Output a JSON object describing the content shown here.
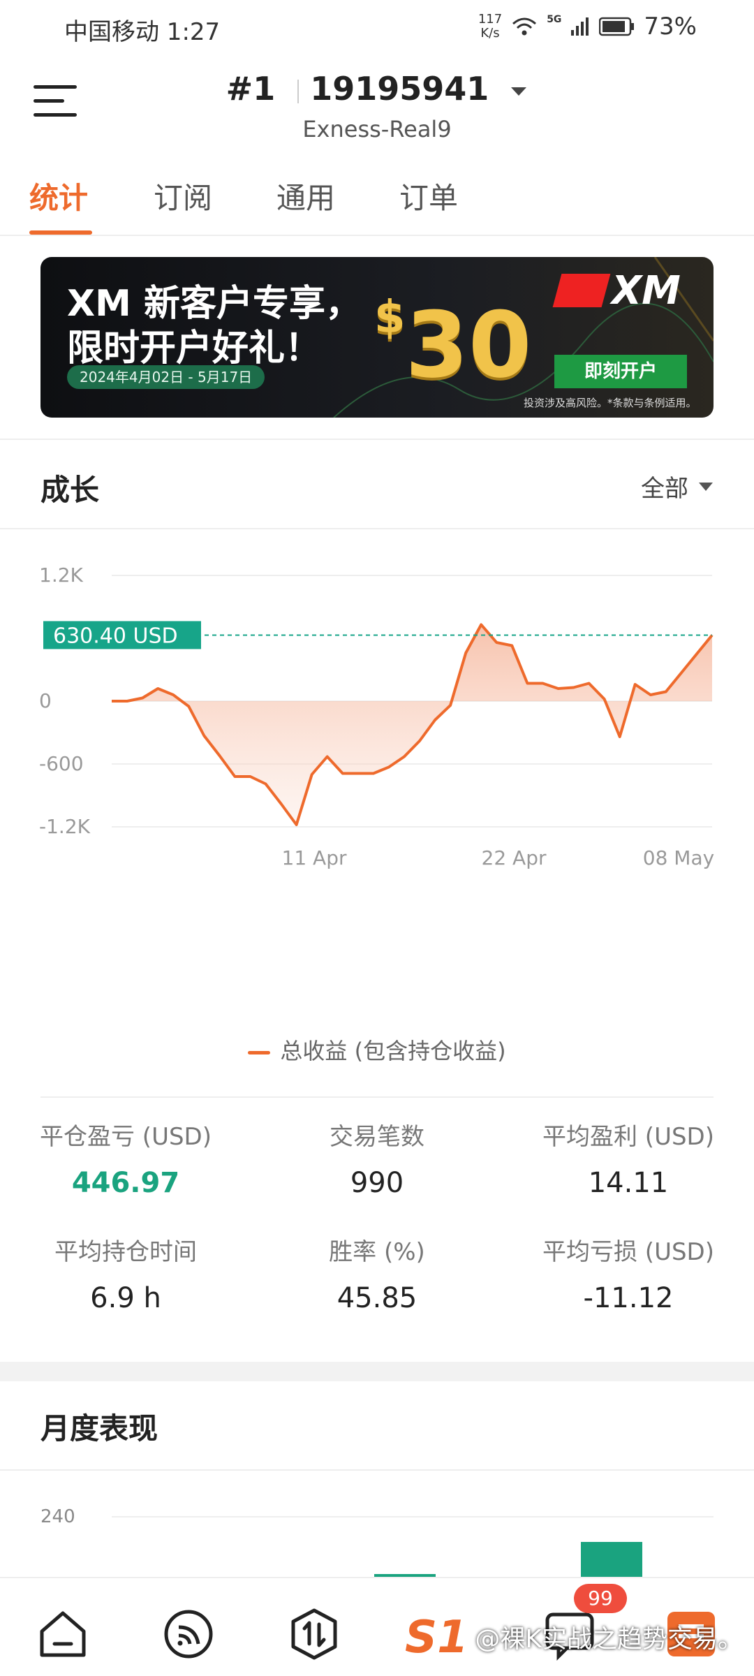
{
  "status_bar": {
    "carrier_time": "中国移动 1:27",
    "net_rate_value": "117",
    "net_rate_unit": "K/s",
    "network": "5G",
    "battery": "73%"
  },
  "header": {
    "rank": "#1",
    "account_number": "19195941",
    "server": "Exness-Real9"
  },
  "tabs": [
    "统计",
    "订阅",
    "通用",
    "订单"
  ],
  "banner": {
    "line1": "XM 新客户专享，",
    "line2": "限时开户好礼！",
    "date_range": "2024年4月02日 - 5月17日",
    "currency": "$",
    "amount": "30",
    "brand": "XM",
    "cta": "即刻开户",
    "disclaimer": "投资涉及高风险。*条款与条例适用。"
  },
  "growth": {
    "title": "成长",
    "range": "全部"
  },
  "chart_data": {
    "type": "area",
    "y_ticks": [
      "1.2K",
      "0",
      "-600",
      "-1.2K"
    ],
    "x_ticks": [
      "11 Apr",
      "22 Apr",
      "08 May"
    ],
    "ylim": [
      -1200,
      1200
    ],
    "current_value_label": "630.40 USD",
    "current_value": 630.4,
    "series": [
      {
        "name": "总收益 (包含持仓收益)",
        "values": [
          0,
          0,
          30,
          120,
          60,
          -50,
          -330,
          -520,
          -720,
          -720,
          -790,
          -980,
          -1180,
          -700,
          -530,
          -690,
          -690,
          -690,
          -630,
          -530,
          -380,
          -180,
          -40,
          460,
          730,
          560,
          530,
          170,
          170,
          120,
          130,
          170,
          20,
          -340,
          160,
          60,
          90,
          270,
          450,
          630
        ]
      }
    ],
    "legend": "总收益 (包含持仓收益)",
    "grid": true
  },
  "stats": [
    {
      "label": "平仓盈亏 (USD)",
      "value": "446.97",
      "style": "green"
    },
    {
      "label": "交易笔数",
      "value": "990",
      "style": "normal"
    },
    {
      "label": "平均盈利 (USD)",
      "value": "14.11",
      "style": "normal"
    },
    {
      "label": "平均持仓时间",
      "value": "6.9 h",
      "style": "normal"
    },
    {
      "label": "胜率 (%)",
      "value": "45.85",
      "style": "normal"
    },
    {
      "label": "平均亏损 (USD)",
      "value": "-11.12",
      "style": "normal"
    }
  ],
  "monthly": {
    "title": "月度表现",
    "y_tick": "240"
  },
  "bottom_nav": {
    "badge": "99",
    "icons": [
      "home-icon",
      "signal-icon",
      "trade-icon",
      "brand-icon",
      "chat-icon",
      "apps-icon"
    ]
  },
  "watermark": "@裸K实战之趋势交易。",
  "colors": {
    "accent": "#ee6a2c",
    "profit_green": "#1aa37f",
    "current_line": "#17a589"
  }
}
